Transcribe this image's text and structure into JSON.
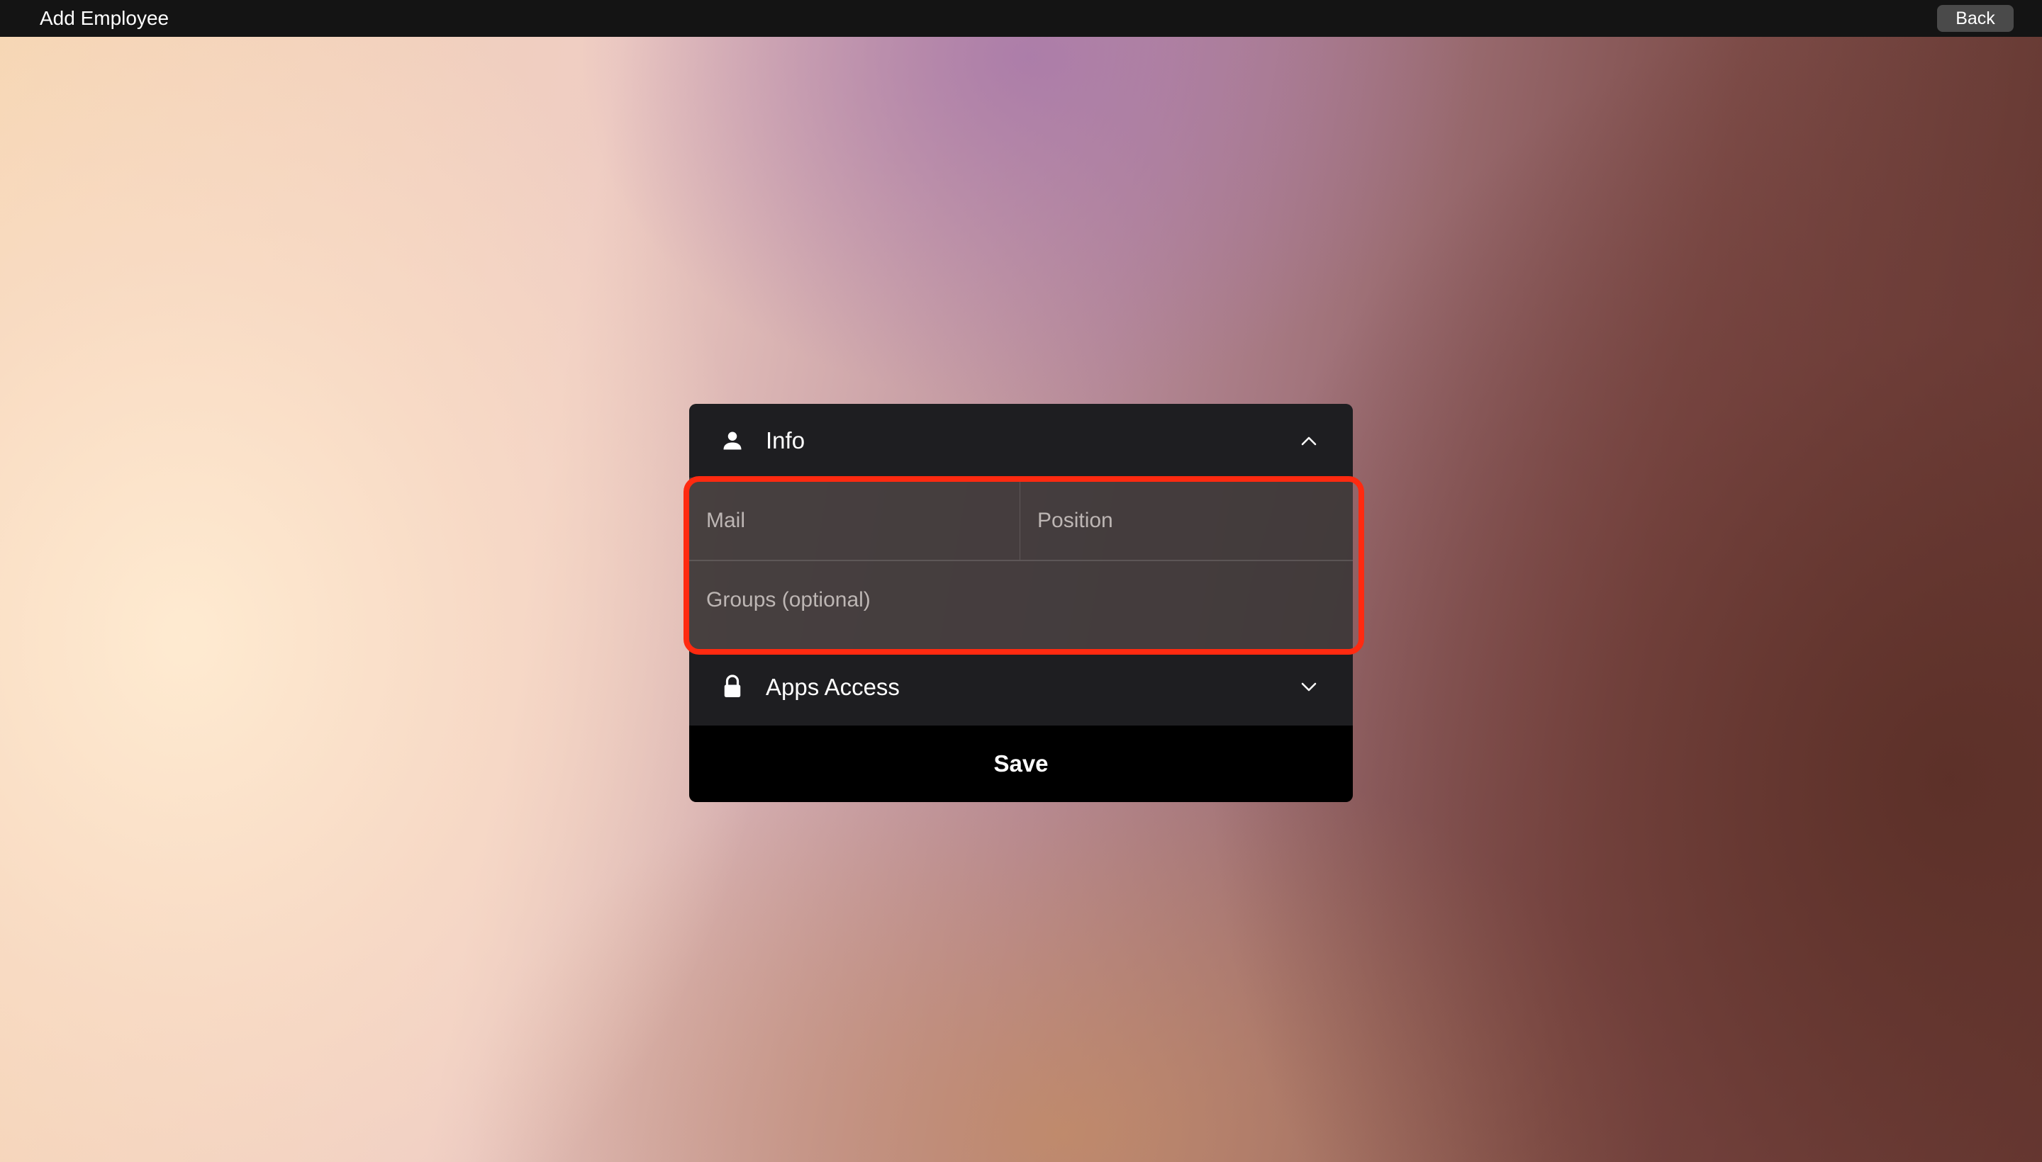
{
  "window": {
    "title": "Add Employee",
    "back_label": "Back"
  },
  "form": {
    "info_section": {
      "label": "Info",
      "icon": "person-icon",
      "expanded": true
    },
    "fields": {
      "mail_placeholder": "Mail",
      "position_placeholder": "Position",
      "groups_placeholder": "Groups (optional)"
    },
    "apps_section": {
      "label": "Apps Access",
      "icon": "lock-icon",
      "expanded": false
    },
    "save_label": "Save"
  },
  "colors": {
    "highlight": "#ff2a10",
    "topbar": "#141414",
    "card_header": "#1e1e21",
    "save_button": "#000000"
  }
}
